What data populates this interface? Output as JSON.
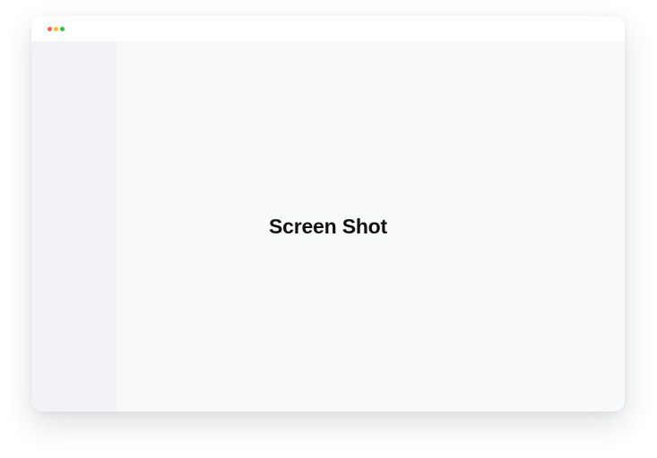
{
  "window": {
    "controls": {
      "close_color": "#ff5f57",
      "minimize_color": "#febc2e",
      "maximize_color": "#28c840"
    }
  },
  "content": {
    "placeholder_text": "Screen Shot"
  },
  "colors": {
    "titlebar": "#ffffff",
    "sidebar": "#f1f3f6",
    "content": "#f8f9fb",
    "text": "#111111"
  }
}
